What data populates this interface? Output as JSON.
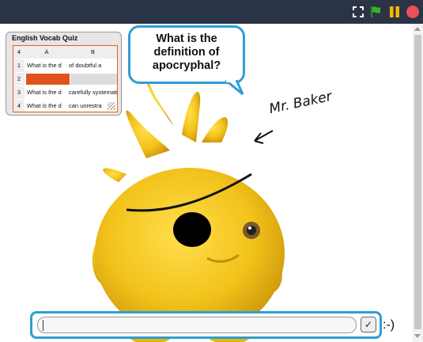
{
  "toolbar": {
    "fullscreen_icon": "fullscreen-icon",
    "flag_icon": "green-flag-icon",
    "pause_icon": "pause-icon",
    "stop_icon": "stop-icon",
    "flag_color": "#2eb82e",
    "pause_color": "#f5b800",
    "stop_color": "#e8505b"
  },
  "list_monitor": {
    "title": "English Vocab Quiz",
    "row_count": "4",
    "columns": [
      "A",
      "B"
    ],
    "rows": [
      {
        "index": "1",
        "a": "What is the d",
        "b": "of doubtful a"
      },
      {
        "index": "2",
        "a": "",
        "b": ""
      },
      {
        "index": "3",
        "a": "What is the d",
        "b": "carefully systematic"
      },
      {
        "index": "4",
        "a": "What is the d",
        "b": "can unrestra"
      }
    ],
    "accent_color": "#e0641c"
  },
  "speech_bubble": {
    "line1": "What is the",
    "line2": "definition of",
    "line3": "apocryphal?"
  },
  "sprite": {
    "signature": "Mr. Baker",
    "body_color": "#f2c21a"
  },
  "answer_box": {
    "value": "",
    "submit_label": "✓"
  }
}
